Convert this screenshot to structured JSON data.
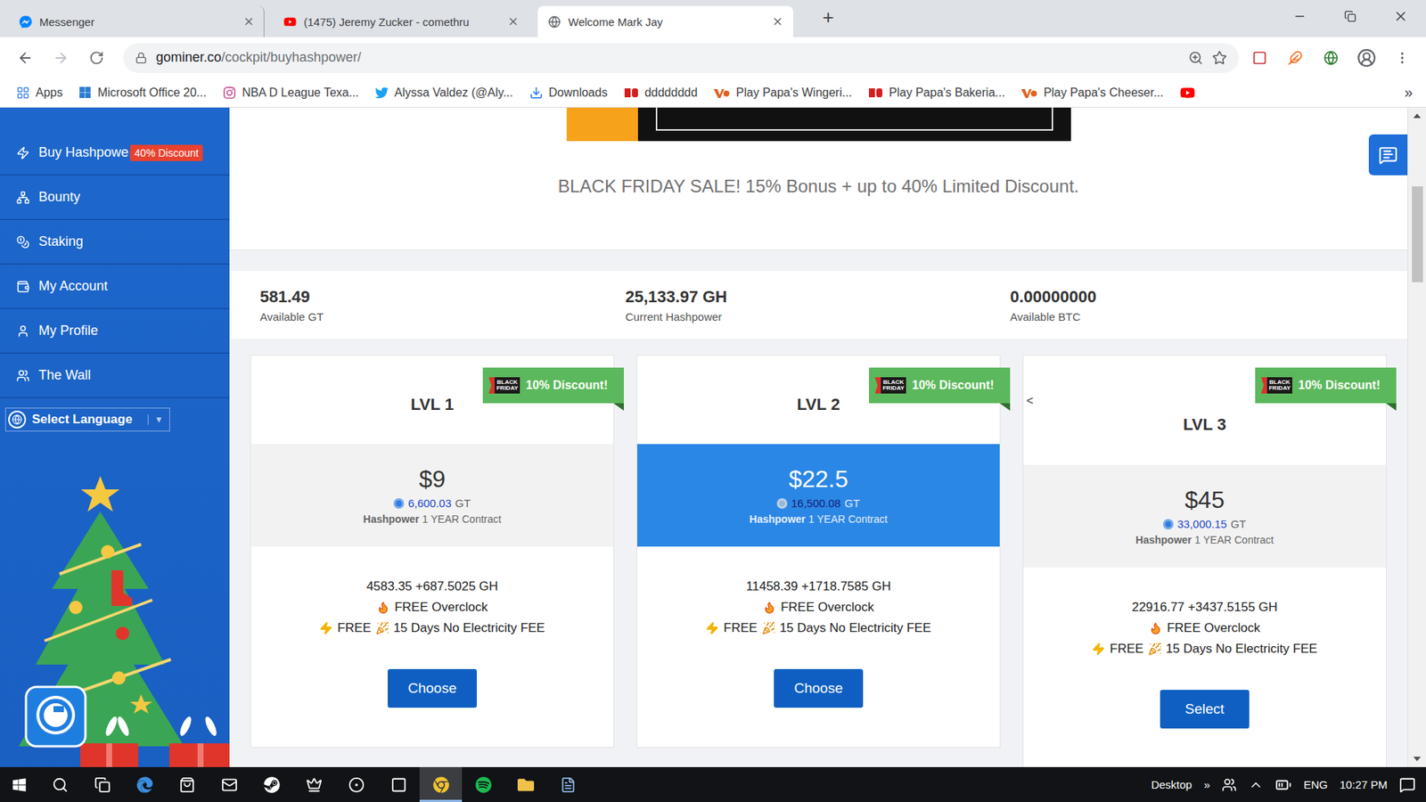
{
  "browser": {
    "tabs": [
      {
        "title": "Messenger",
        "selected": false
      },
      {
        "title": "(1475) Jeremy Zucker - comethru",
        "selected": false
      },
      {
        "title": "Welcome Mark Jay",
        "selected": true
      }
    ],
    "new_tab": "+",
    "navigation": {
      "back": {
        "disabled": false
      },
      "forward": {
        "disabled": true
      }
    },
    "address": {
      "host": "gominer.co",
      "path": "/cockpit/buyhashpower/"
    },
    "bookmarks": [
      {
        "label": "Apps"
      },
      {
        "label": "Microsoft Office 20..."
      },
      {
        "label": "NBA D League Texa..."
      },
      {
        "label": "Alyssa Valdez (@Aly..."
      },
      {
        "label": "Downloads"
      },
      {
        "label": "dddddddd"
      },
      {
        "label": "Play Papa's Wingeri..."
      },
      {
        "label": "Play Papa's Bakeria..."
      },
      {
        "label": "Play Papa's Cheeser..."
      },
      {
        "label": ""
      }
    ],
    "bookmarks_more": "»"
  },
  "sidebar": {
    "items": [
      {
        "label": "Buy Hashpowe",
        "badge": "40% Discount"
      },
      {
        "label": "Bounty",
        "badge": ""
      },
      {
        "label": "Staking",
        "badge": ""
      },
      {
        "label": "My Account",
        "badge": ""
      },
      {
        "label": "My Profile",
        "badge": ""
      },
      {
        "label": "The Wall",
        "badge": ""
      }
    ],
    "language": {
      "label": "Select Language",
      "arrow": "▼"
    }
  },
  "page": {
    "headline": "BLACK FRIDAY SALE! 15% Bonus + up to 40% Limited Discount.",
    "stats": [
      {
        "value": "581.49",
        "label": "Available GT"
      },
      {
        "value": "25,133.97 GH",
        "label": "Current Hashpower"
      },
      {
        "value": "0.00000000",
        "label": "Available BTC"
      }
    ],
    "plans": [
      {
        "level": "LVL 1",
        "tag": "BLACK FRIDAY",
        "ribbon": "10% Discount!",
        "price": "$9",
        "gt": "6,600.03",
        "unit": "GT",
        "contract_lead": "Hashpower",
        "contract": "1 YEAR Contract",
        "hashpower": "4583.35 +687.5025 GH",
        "features": [
          {
            "lead": "",
            "text": "FREE Overclock"
          },
          {
            "lead": "FREE",
            "text": "15 Days No Electricity FEE"
          }
        ],
        "button": "Choose",
        "selected": false,
        "marker": ""
      },
      {
        "level": "LVL 2",
        "tag": "BLACK FRIDAY",
        "ribbon": "10% Discount!",
        "price": "$22.5",
        "gt": "16,500.08",
        "unit": "GT",
        "contract_lead": "Hashpower",
        "contract": "1 YEAR Contract",
        "hashpower": "11458.39 +1718.7585 GH",
        "features": [
          {
            "lead": "",
            "text": "FREE Overclock"
          },
          {
            "lead": "FREE",
            "text": "15 Days No Electricity FEE"
          }
        ],
        "button": "Choose",
        "selected": true,
        "marker": ""
      },
      {
        "level": "LVL 3",
        "tag": "BLACK FRIDAY",
        "ribbon": "10% Discount!",
        "price": "$45",
        "gt": "33,000.15",
        "unit": "GT",
        "contract_lead": "Hashpower",
        "contract": "1 YEAR Contract",
        "hashpower": "22916.77 +3437.5155 GH",
        "features": [
          {
            "lead": "",
            "text": "FREE Overclock"
          },
          {
            "lead": "FREE",
            "text": "15 Days No Electricity FEE"
          }
        ],
        "button": "Select",
        "selected": false,
        "marker": "<"
      }
    ]
  },
  "taskbar": {
    "pinned": [
      {
        "active": false
      },
      {
        "active": false
      },
      {
        "active": false
      },
      {
        "active": false
      },
      {
        "active": false
      },
      {
        "active": false
      },
      {
        "active": false
      },
      {
        "active": true
      },
      {
        "active": false
      },
      {
        "active": false
      },
      {
        "active": false
      }
    ],
    "desktop": "Desktop",
    "more": "»",
    "language": "ENG",
    "time": "10:27 PM"
  }
}
